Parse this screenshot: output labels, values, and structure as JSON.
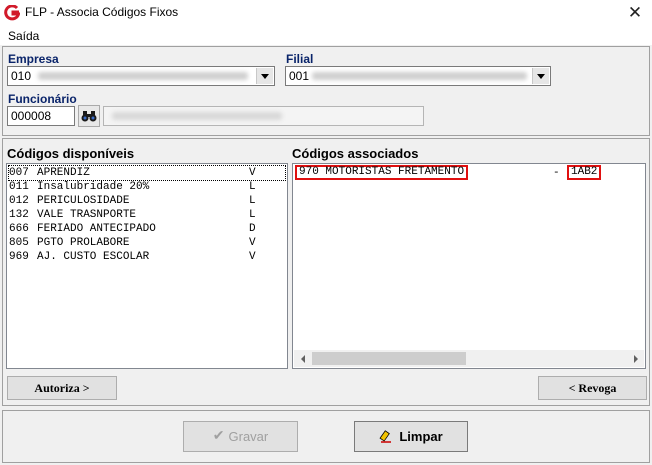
{
  "window": {
    "title": "FLP - Associa Códigos Fixos",
    "close_glyph": "✕"
  },
  "menu": {
    "items": [
      "Saída"
    ]
  },
  "empresa": {
    "label": "Empresa",
    "code": "010"
  },
  "filial": {
    "label": "Filial",
    "code": "001"
  },
  "funcionario": {
    "label": "Funcionário",
    "code": "000008"
  },
  "disponiveis": {
    "title": "Códigos disponíveis",
    "items": [
      {
        "code": "007",
        "name": "APRENDIZ",
        "type": "V"
      },
      {
        "code": "011",
        "name": "Insalubridade 20%",
        "type": "L"
      },
      {
        "code": "012",
        "name": "PERICULOSIDADE",
        "type": "L"
      },
      {
        "code": "132",
        "name": "VALE TRASNPORTE",
        "type": "L"
      },
      {
        "code": "666",
        "name": "FERIADO ANTECIPADO",
        "type": "D"
      },
      {
        "code": "805",
        "name": "PGTO PROLABORE",
        "type": "V"
      },
      {
        "code": "969",
        "name": "AJ. CUSTO ESCOLAR",
        "type": "V"
      }
    ]
  },
  "associados": {
    "title": "Códigos associados",
    "items": [
      {
        "code": "970",
        "name": "MOTORISTAS FRETAMENTO",
        "sep": "-",
        "extra": "1AB2"
      }
    ]
  },
  "buttons": {
    "autoriza": "Autoriza >",
    "revoga": "< Revoga",
    "gravar": "Gravar",
    "limpar": "Limpar"
  },
  "colors": {
    "highlight_border": "#e01010",
    "label_blue": "#0a246a",
    "disabled_text": "#a0a0a0"
  }
}
